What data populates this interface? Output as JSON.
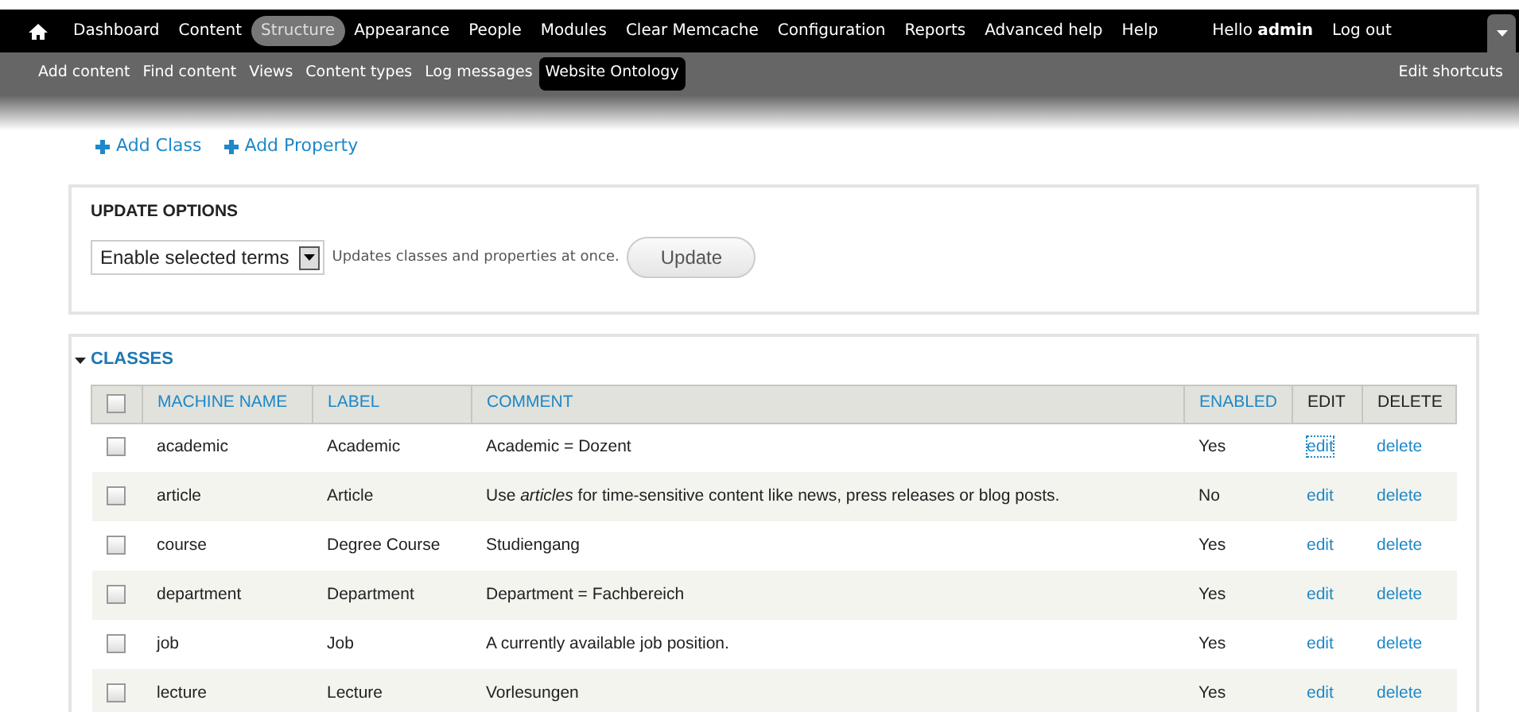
{
  "toolbar": {
    "menu": [
      {
        "label": "Dashboard",
        "selected": false
      },
      {
        "label": "Content",
        "selected": false
      },
      {
        "label": "Structure",
        "selected": true
      },
      {
        "label": "Appearance",
        "selected": false
      },
      {
        "label": "People",
        "selected": false
      },
      {
        "label": "Modules",
        "selected": false
      },
      {
        "label": "Clear Memcache",
        "selected": false
      },
      {
        "label": "Configuration",
        "selected": false
      },
      {
        "label": "Reports",
        "selected": false
      },
      {
        "label": "Advanced help",
        "selected": false
      },
      {
        "label": "Help",
        "selected": false
      }
    ],
    "greeting": "Hello **admin**",
    "logout": "Log out"
  },
  "shortcuts": {
    "items": [
      {
        "label": "Add content",
        "selected": false
      },
      {
        "label": "Find content",
        "selected": false
      },
      {
        "label": "Views",
        "selected": false
      },
      {
        "label": "Content types",
        "selected": false
      },
      {
        "label": "Log messages",
        "selected": false
      },
      {
        "label": "Website Ontology",
        "selected": true
      }
    ],
    "edit": "Edit shortcuts"
  },
  "actions": [
    "Add Class",
    "Add Property"
  ],
  "update_options": {
    "title": "UPDATE OPTIONS",
    "select": "Enable selected terms",
    "description": "Updates classes and properties at once.",
    "button": "Update"
  },
  "classes": {
    "title": "CLASSES",
    "expanded": true,
    "columns": [
      {
        "label": "MACHINE NAME",
        "sortable": true
      },
      {
        "label": "LABEL",
        "sortable": true
      },
      {
        "label": "COMMENT",
        "sortable": true
      },
      {
        "label": "ENABLED",
        "sortable": true
      },
      {
        "label": "EDIT",
        "sortable": false
      },
      {
        "label": "DELETE",
        "sortable": false
      }
    ],
    "select_all": false,
    "rows": [
      {
        "checked": false,
        "machine_name": "academic",
        "label": "Academic",
        "comment": "Academic = Dozent",
        "enabled": "Yes",
        "edit": "edit",
        "edit_focused": true,
        "delete": "delete"
      },
      {
        "checked": false,
        "machine_name": "article",
        "label": "Article",
        "comment": "Use *articles* for time-sensitive content like news, press releases or blog posts.",
        "enabled": "No",
        "edit": "edit",
        "edit_focused": false,
        "delete": "delete"
      },
      {
        "checked": false,
        "machine_name": "course",
        "label": "Degree Course",
        "comment": "Studiengang",
        "enabled": "Yes",
        "edit": "edit",
        "edit_focused": false,
        "delete": "delete"
      },
      {
        "checked": false,
        "machine_name": "department",
        "label": "Department",
        "comment": "Department = Fachbereich",
        "enabled": "Yes",
        "edit": "edit",
        "edit_focused": false,
        "delete": "delete"
      },
      {
        "checked": false,
        "machine_name": "job",
        "label": "Job",
        "comment": "A currently available job position.",
        "enabled": "Yes",
        "edit": "edit",
        "edit_focused": false,
        "delete": "delete"
      },
      {
        "checked": false,
        "machine_name": "lecture",
        "label": "Lecture",
        "comment": "Vorlesungen",
        "enabled": "Yes",
        "edit": "edit",
        "edit_focused": false,
        "delete": "delete"
      }
    ]
  }
}
